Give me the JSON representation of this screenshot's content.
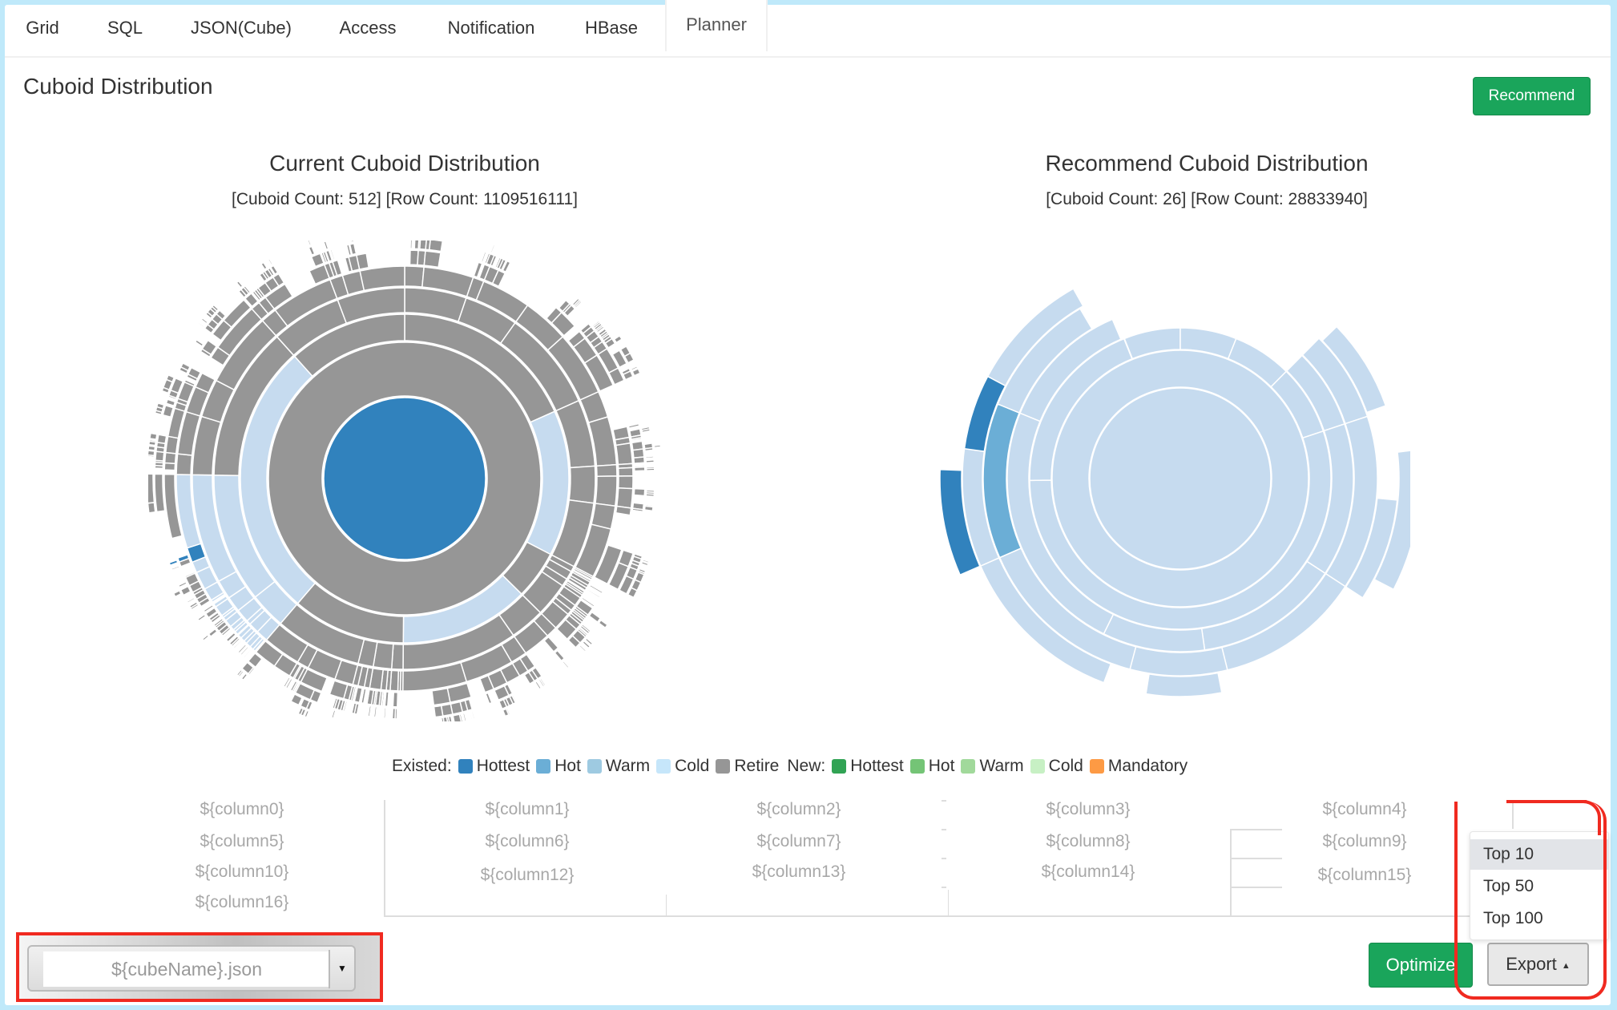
{
  "tabs": [
    {
      "label": "Grid",
      "active": false
    },
    {
      "label": "SQL",
      "active": false
    },
    {
      "label": "JSON(Cube)",
      "active": false
    },
    {
      "label": "Access",
      "active": false
    },
    {
      "label": "Notification",
      "active": false
    },
    {
      "label": "HBase",
      "active": false
    },
    {
      "label": "Planner",
      "active": true
    }
  ],
  "section_title": "Cuboid Distribution",
  "recommend_button": "Recommend",
  "optimize_button": "Optimize",
  "export_button": "Export",
  "export_caret": "▲",
  "export_menu": [
    "Top 10",
    "Top 50",
    "Top 100"
  ],
  "export_menu_highlighted": "Top 10",
  "file_select": {
    "value": "${cubeName}.json",
    "caret": "▼"
  },
  "colors": {
    "existed_hottest": "#3182bd",
    "existed_hot": "#6baed6",
    "existed_warm": "#9ecae1",
    "existed_cold": "#c6dbef",
    "retire": "#969696",
    "new_hottest": "#31a354",
    "new_hot": "#74c476",
    "new_warm": "#a1d99b",
    "new_cold": "#c7e9c0",
    "mandatory": "#fd8d3c",
    "accent": "#3c8dbc",
    "button_green": "#1aa55b",
    "annotation_red": "#f02a20"
  },
  "legend": {
    "existed_label": "Existed:",
    "new_label": "New:",
    "existed_items": [
      {
        "label": "Hottest",
        "color": "#3182bd"
      },
      {
        "label": "Hot",
        "color": "#6baed6"
      },
      {
        "label": "Warm",
        "color": "#9ecae1"
      },
      {
        "label": "Cold",
        "color": "#c6e6fa"
      },
      {
        "label": "Retire",
        "color": "#969696"
      }
    ],
    "new_items": [
      {
        "label": "Hottest",
        "color": "#31a354"
      },
      {
        "label": "Hot",
        "color": "#74c476"
      },
      {
        "label": "Warm",
        "color": "#a1d99b"
      },
      {
        "label": "Cold",
        "color": "#c7f0c4"
      },
      {
        "label": "Mandatory",
        "color": "#fd9a44"
      }
    ]
  },
  "columns": [
    "${column0}",
    "${column1}",
    "${column2}",
    "${column3}",
    "${column4}",
    "${column5}",
    "${column6}",
    "${column7}",
    "${column8}",
    "${column9}",
    "${column10}",
    "${column12}",
    "${column13}",
    "${column14}",
    "${column15}",
    "${column16}"
  ],
  "chart_data": [
    {
      "type": "sunburst",
      "title": "Current Cuboid Distribution",
      "subtitle": "[Cuboid Count: 512] [Row Count: 1109516111]",
      "cuboid_count": 512,
      "row_count": 1109516111,
      "levels": 9,
      "root_category": "Hottest",
      "dominant_category": "Retire",
      "categories_present": [
        "Hottest",
        "Cold",
        "Retire"
      ]
    },
    {
      "type": "sunburst",
      "title": "Recommend Cuboid Distribution",
      "subtitle": "[Cuboid Count: 26] [Row Count: 28833940]",
      "cuboid_count": 26,
      "row_count": 28833940,
      "levels": 6,
      "root_category": "Cold",
      "dominant_category": "Cold",
      "categories_present": [
        "Hottest",
        "Hot",
        "Cold"
      ]
    }
  ]
}
